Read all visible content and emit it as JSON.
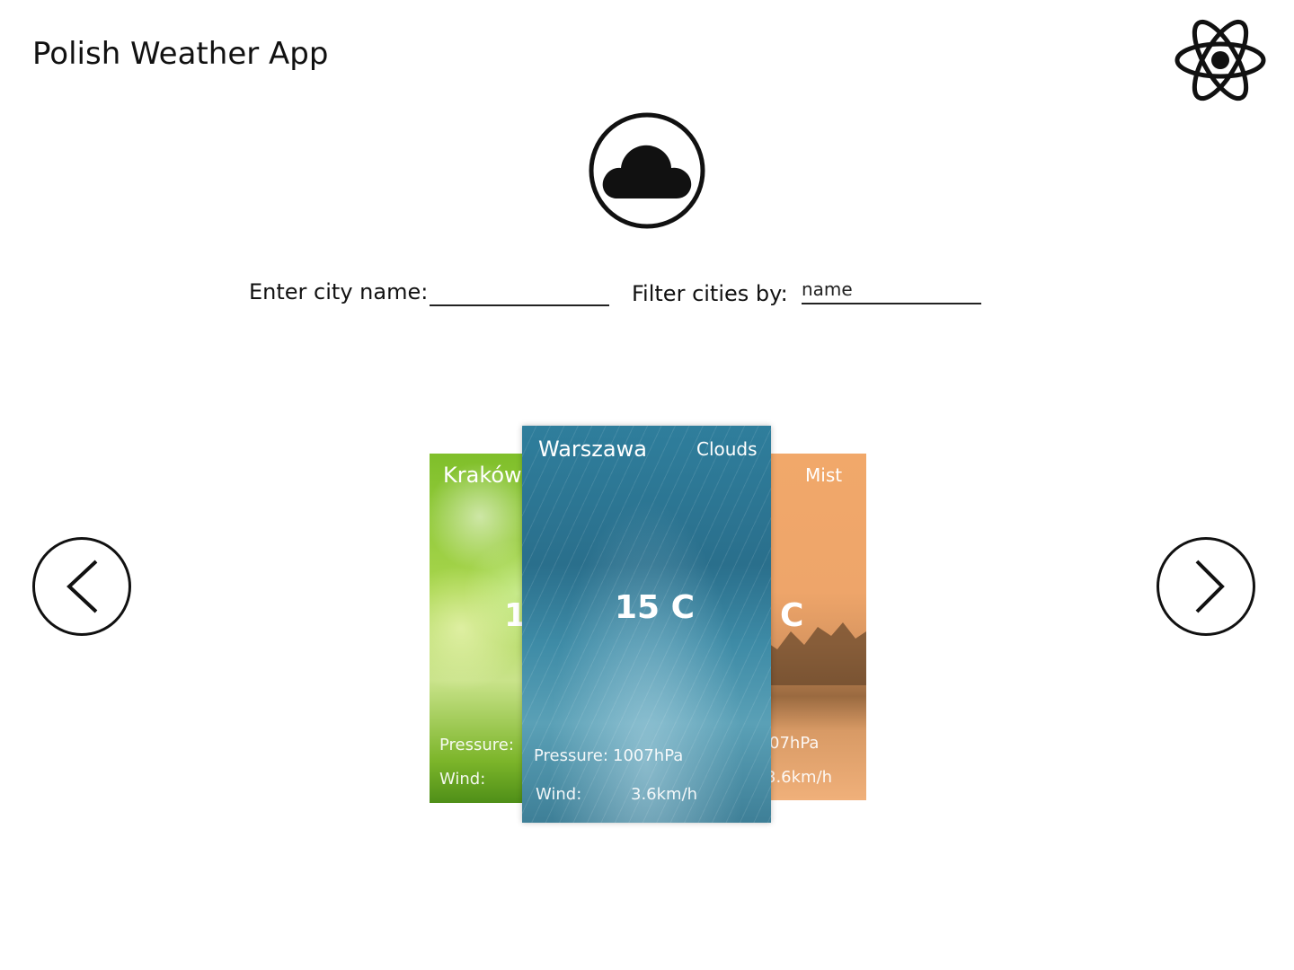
{
  "app": {
    "title": "Polish Weather App"
  },
  "header": {
    "logo_icon": "react-atom-icon",
    "weather_icon": "cloud-icon"
  },
  "search": {
    "city_label": "Enter city name:",
    "city_value": "",
    "city_placeholder": "",
    "filter_label": "Filter cities by:",
    "filter_value": "name"
  },
  "carousel": {
    "prev_icon": "chevron-left-icon",
    "next_icon": "chevron-right-icon",
    "cards": [
      {
        "city": "Kraków",
        "condition": "",
        "temperature": "1",
        "pressure_label": "Pressure:",
        "pressure_value": "",
        "wind_label": "Wind:",
        "wind_value": ""
      },
      {
        "city": "Warszawa",
        "condition": "Clouds",
        "temperature": "15 C",
        "pressure_label": "Pressure:",
        "pressure_value": "1007hPa",
        "wind_label": "Wind:",
        "wind_value": "3.6km/h"
      },
      {
        "city": "",
        "condition": "Mist",
        "temperature": "C",
        "pressure_label": "",
        "pressure_value": "07hPa",
        "wind_label": "",
        "wind_value": "3.6km/h"
      }
    ]
  }
}
